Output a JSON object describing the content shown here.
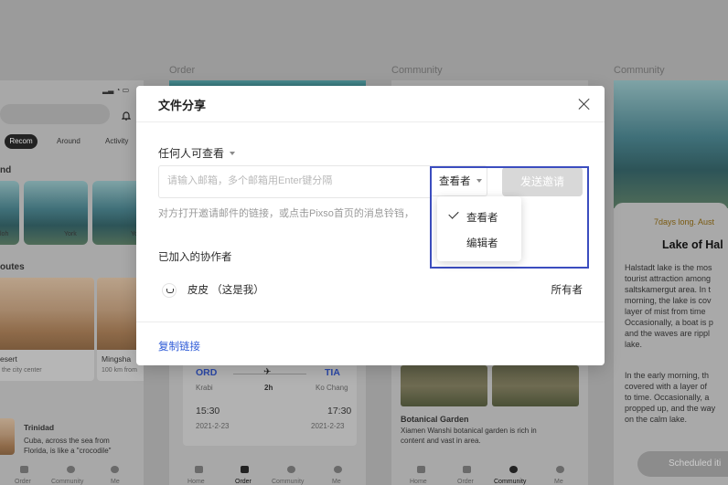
{
  "background": {
    "frames": [
      {
        "label": "Order"
      },
      {
        "label": "Community"
      },
      {
        "label": "Community"
      }
    ],
    "phone1": {
      "tabs": [
        "Recom",
        "Around",
        "Activity"
      ],
      "section_nd": "nd",
      "section_routes": "outes",
      "thumbs": [
        "loh",
        "York",
        "Yo"
      ],
      "card1_title": "esert",
      "card1_sub": "the city center",
      "card2_title": "Mingsha",
      "card2_sub": "100 km from",
      "story_name": "Trinidad",
      "story_text_1": "Cuba, across the sea from",
      "story_text_2": "Florida, is like a \"crocodile\"",
      "nav": [
        "Order",
        "Community",
        "Me"
      ]
    },
    "phone2": {
      "from_code": "ORD",
      "to_code": "TIA",
      "from_city": "Krabi",
      "duration": "2h",
      "to_city": "Ko Chang",
      "dep_time": "15:30",
      "arr_time": "17:30",
      "dep_date": "2021-2-23",
      "arr_date": "2021-2-23",
      "nav": [
        "Home",
        "Order",
        "Community",
        "Me"
      ]
    },
    "phone3": {
      "title": "Botanical Garden",
      "desc_1": "Xiamen Wanshi botanical garden is rich in",
      "desc_2": "content and vast in area.",
      "nav": [
        "Home",
        "Order",
        "Community",
        "Me"
      ]
    },
    "phone4": {
      "subtitle": "7days long. Aust",
      "title": "Lake of Hal",
      "p1": [
        "Halstadt lake is the mos",
        "tourist attraction among",
        "saltskamergut area. In t",
        "morning, the lake is cov",
        "layer of mist from time",
        "Occasionally, a boat is p",
        "and the waves are rippl",
        "lake."
      ],
      "p2": [
        "In the early morning, th",
        "covered with a layer of",
        "to time. Occasionally, a",
        "propped up, and the way",
        "on the calm lake."
      ],
      "cta": "Scheduled iti"
    }
  },
  "dialog": {
    "title": "文件分享",
    "permission": "任何人可查看",
    "email_placeholder": "请输入邮箱，多个邮箱用Enter键分隔",
    "role_selected": "查看者",
    "send_label": "发送邀请",
    "hint": "对方打开邀请邮件的链接，或点击Pixso首页的消息铃铛，",
    "collaborators_title": "已加入的协作者",
    "collaborators": [
      {
        "name": "皮皮 （这是我）",
        "role": "所有者"
      }
    ],
    "copy_link": "复制链接"
  },
  "role_menu": {
    "options": [
      "查看者",
      "编辑者"
    ],
    "selected_index": 0
  },
  "colors": {
    "accent": "#2c59d6",
    "highlight_border": "#3b4dbf",
    "send_disabled": "#d8d8d8"
  }
}
